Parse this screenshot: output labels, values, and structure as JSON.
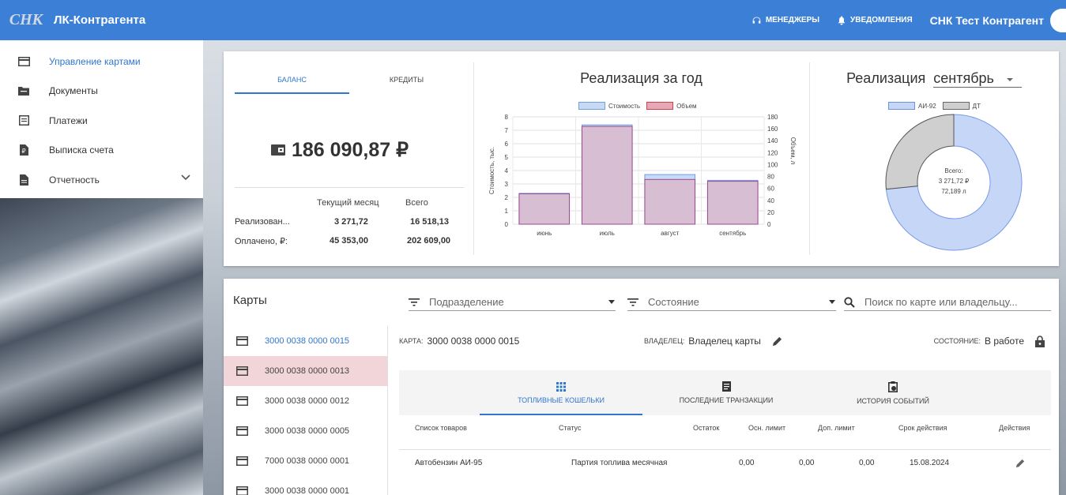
{
  "header": {
    "logo_text": "СНК",
    "title": "ЛК-Контрагента",
    "managers": "менеджеры",
    "notifications": "уведомления",
    "user": "СНК Тест Контрагент"
  },
  "sidebar": {
    "items": [
      {
        "label": "Управление картами",
        "icon": "credit-card-icon"
      },
      {
        "label": "Документы",
        "icon": "folder-icon"
      },
      {
        "label": "Платежи",
        "icon": "list-icon"
      },
      {
        "label": "Выписка счета",
        "icon": "ruble-document-icon"
      },
      {
        "label": "Отчетность",
        "icon": "file-icon"
      }
    ]
  },
  "balance_panel": {
    "tabs": [
      "Баланс",
      "Кредиты"
    ],
    "amount": "186 090,87 ₽",
    "col_current": "Текущий месяц",
    "col_total": "Всего",
    "rows": [
      {
        "label": "Реализован...",
        "current": "3 271,72",
        "total": "16 518,13"
      },
      {
        "label": "Оплачено, ₽:",
        "current": "45 353,00",
        "total": "202 609,00"
      }
    ]
  },
  "year_chart": {
    "title": "Реализация за год",
    "chart_data": {
      "type": "bar",
      "categories": [
        "июнь",
        "июль",
        "август",
        "сентябрь"
      ],
      "series": [
        {
          "name": "Стоимость",
          "values": [
            2.3,
            7.4,
            3.7,
            3.27
          ],
          "color": "#c6daf5"
        },
        {
          "name": "Объем",
          "values": [
            51,
            164,
            75,
            72
          ],
          "color": "#e8a7b4"
        }
      ],
      "ylabel": "Стоимость, тыс.",
      "y2label": "Объем, л",
      "ylim": [
        0,
        8
      ],
      "y2lim": [
        0,
        180
      ],
      "yticks": [
        0,
        1,
        2,
        3,
        4,
        5,
        6,
        7,
        8
      ],
      "y2ticks": [
        0,
        20,
        40,
        60,
        80,
        100,
        120,
        140,
        160,
        180
      ]
    }
  },
  "month_chart": {
    "title": "Реализация",
    "month": "сентябрь",
    "chart_data": {
      "type": "pie",
      "labels": [
        "АИ-92",
        "ДТ"
      ],
      "values": [
        2.4,
        0.87
      ],
      "colors": [
        "#c6d6f7",
        "#cfcfcf"
      ]
    },
    "center": [
      "Всего:",
      "3 271,72 ₽",
      "72,189 л"
    ]
  },
  "cards": {
    "title": "Карты",
    "filter_division": "Подразделение",
    "filter_state": "Состояние",
    "search_placeholder": "Поиск по карте или владельцу...",
    "list": [
      "3000 0038 0000 0015",
      "3000 0038 0000 0013",
      "3000 0038 0000 0012",
      "3000 0038 0000 0005",
      "7000 0038 0000 0001",
      "3000 0038 0000 0001"
    ],
    "detail": {
      "card_label": "Карта:",
      "card_value": "3000 0038 0000 0015",
      "owner_label": "Владелец:",
      "owner_value": "Владелец карты",
      "state_label": "Состояние:",
      "state_value": "В работе",
      "tabs": [
        "Топливные кошельки",
        "Последние транзакции",
        "История событий"
      ],
      "columns": [
        "Список товаров",
        "Статус",
        "Остаток",
        "Осн. лимит",
        "Доп. лимит",
        "Срок действия",
        "Действия"
      ],
      "row": {
        "product": "Автобензин АИ-95",
        "status": "Партия топлива месячная",
        "balance": "0,00",
        "main_limit": "0,00",
        "extra_limit": "0,00",
        "expiry": "15.08.2024"
      }
    }
  }
}
